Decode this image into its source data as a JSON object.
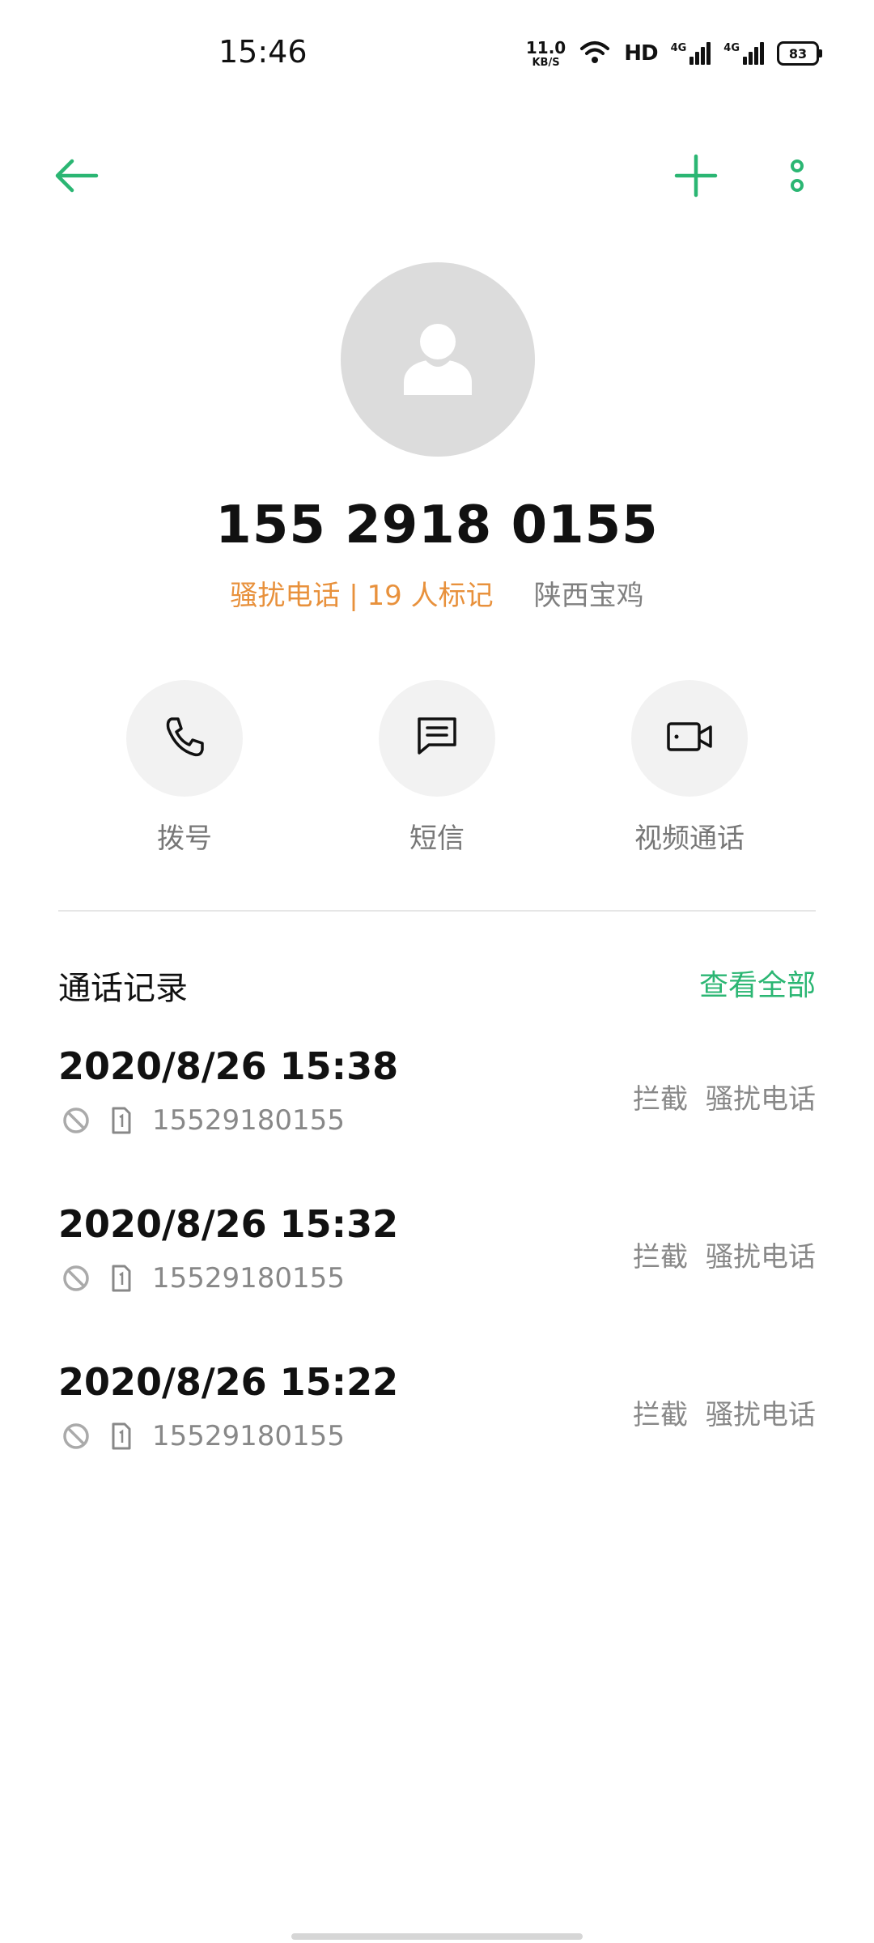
{
  "status_bar": {
    "time": "15:46",
    "net_speed_value": "11.0",
    "net_speed_unit": "KB/S",
    "hd_label": "HD",
    "signal1_label": "4G",
    "signal2_label": "4G",
    "battery": "83"
  },
  "toolbar": {
    "back_icon": "arrow-left",
    "add_icon": "plus",
    "more_icon": "vertical-dots"
  },
  "contact": {
    "avatar_icon": "person-silhouette",
    "phone": "155 2918 0155",
    "spam_tag": "骚扰电话 | 19 人标记",
    "location": "陕西宝鸡"
  },
  "actions": [
    {
      "label": "拨号",
      "icon": "phone-icon"
    },
    {
      "label": "短信",
      "icon": "message-icon"
    },
    {
      "label": "视频通话",
      "icon": "video-icon"
    }
  ],
  "call_log": {
    "title": "通话记录",
    "view_all": "查看全部",
    "records": [
      {
        "time": "2020/8/26 15:38",
        "number": "15529180155",
        "status": "拦截",
        "type": "骚扰电话"
      },
      {
        "time": "2020/8/26 15:32",
        "number": "15529180155",
        "status": "拦截",
        "type": "骚扰电话"
      },
      {
        "time": "2020/8/26 15:22",
        "number": "15529180155",
        "status": "拦截",
        "type": "骚扰电话"
      }
    ]
  },
  "colors": {
    "accent": "#2bb673",
    "spam": "#e8913c",
    "avatar_bg": "#dcdcdc"
  }
}
